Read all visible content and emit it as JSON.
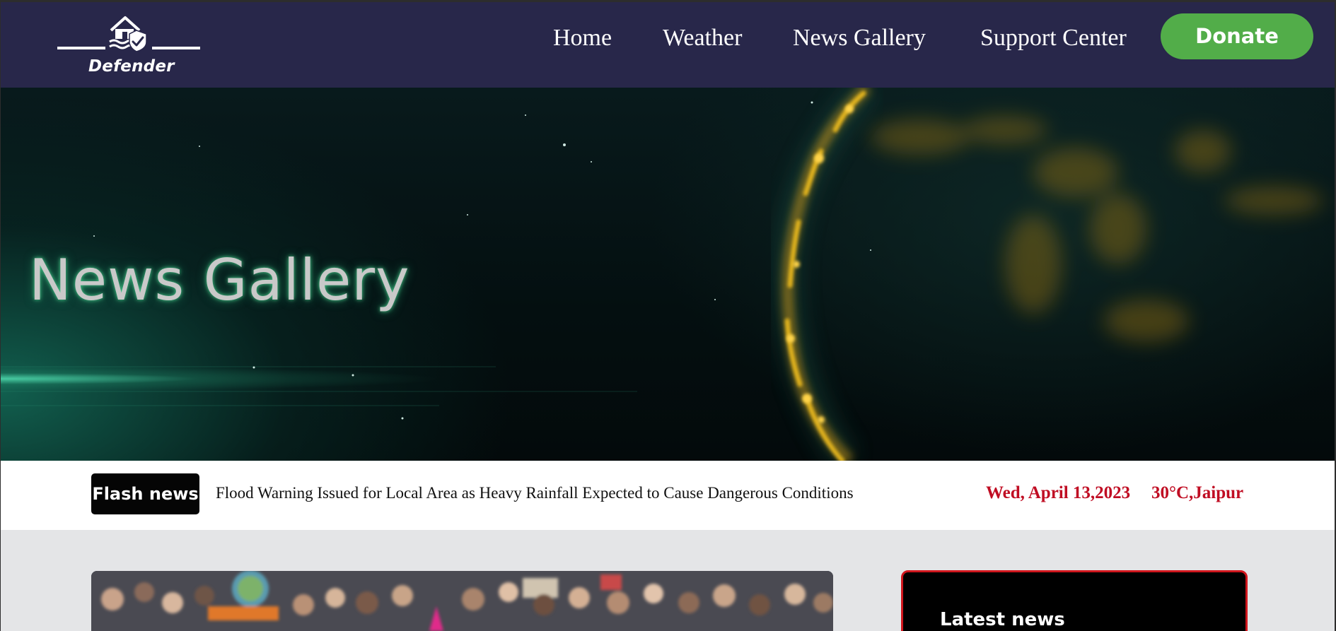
{
  "brand": {
    "name": "Defender",
    "logo_icon": "house-shield-icon"
  },
  "nav": {
    "links": [
      "Home",
      "Weather",
      "News Gallery",
      "Support Center"
    ],
    "donate_label": "Donate"
  },
  "hero": {
    "title": "News Gallery"
  },
  "flash": {
    "badge": "Flash news",
    "headline": "Flood Warning Issued for Local Area as Heavy Rainfall Expected to Cause Dangerous Conditions",
    "date": "Wed, April 13,2023",
    "weather": "30°C,Jaipur"
  },
  "sidebar": {
    "title": "Latest news"
  },
  "colors": {
    "navbar": "#28274a",
    "donate": "#52ad49",
    "flash_accent": "#c00d23",
    "card_border": "#d0161d",
    "page_bg": "#e4e5e7"
  }
}
